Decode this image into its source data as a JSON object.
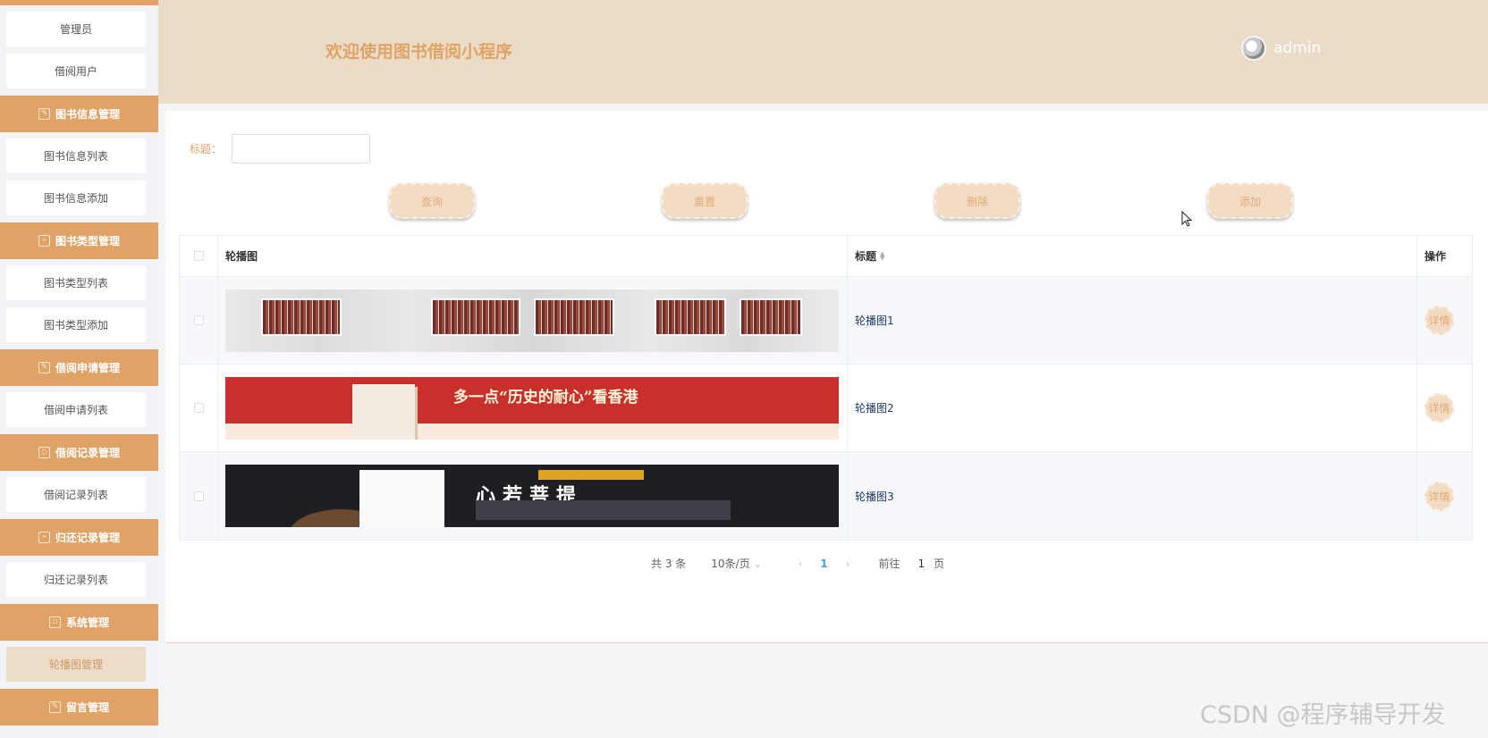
{
  "sidebar": {
    "top_items": [
      "管理员",
      "借阅用户"
    ],
    "groups": [
      {
        "label": "图书信息管理",
        "icon": "edit-icon",
        "items": [
          "图书信息列表",
          "图书信息添加"
        ]
      },
      {
        "label": "图书类型管理",
        "icon": "chart-icon",
        "items": [
          "图书类型列表",
          "图书类型添加"
        ]
      },
      {
        "label": "借阅申请管理",
        "icon": "edit-icon",
        "items": [
          "借阅申请列表"
        ]
      },
      {
        "label": "借阅记录管理",
        "icon": "bookmark-icon",
        "items": [
          "借阅记录列表"
        ]
      },
      {
        "label": "归还记录管理",
        "icon": "chart-icon",
        "items": [
          "归还记录列表"
        ]
      },
      {
        "label": "系统管理",
        "icon": "system-icon",
        "items": [
          "轮播图管理"
        ]
      },
      {
        "label": "留言管理",
        "icon": "edit-icon",
        "items": []
      }
    ]
  },
  "header": {
    "welcome": "欢迎使用图书借阅小程序",
    "username": "admin"
  },
  "search": {
    "label": "标题：",
    "value": ""
  },
  "buttons": {
    "query": "查询",
    "reset": "重置",
    "delete": "删除",
    "add": "添加"
  },
  "table": {
    "headers": {
      "image": "轮播图",
      "title": "标题",
      "actions": "操作"
    },
    "rows": [
      {
        "title": "轮播图1",
        "action": "详情"
      },
      {
        "title": "轮播图2",
        "action": "详情"
      },
      {
        "title": "轮播图3",
        "action": "详情"
      }
    ],
    "banner2_text": "多一点“历史的耐心”看香港",
    "banner3_text": "心若菩提"
  },
  "pagination": {
    "total": "共 3 条",
    "page_size": "10条/页",
    "current": "1",
    "goto_label": "前往",
    "goto_value": "1",
    "page_suffix": "页"
  },
  "watermark": "CSDN @程序辅导开发",
  "colors": {
    "accent": "#e0a366",
    "header_bg": "#ebdcc8",
    "button_bg": "#f3dcc4"
  }
}
